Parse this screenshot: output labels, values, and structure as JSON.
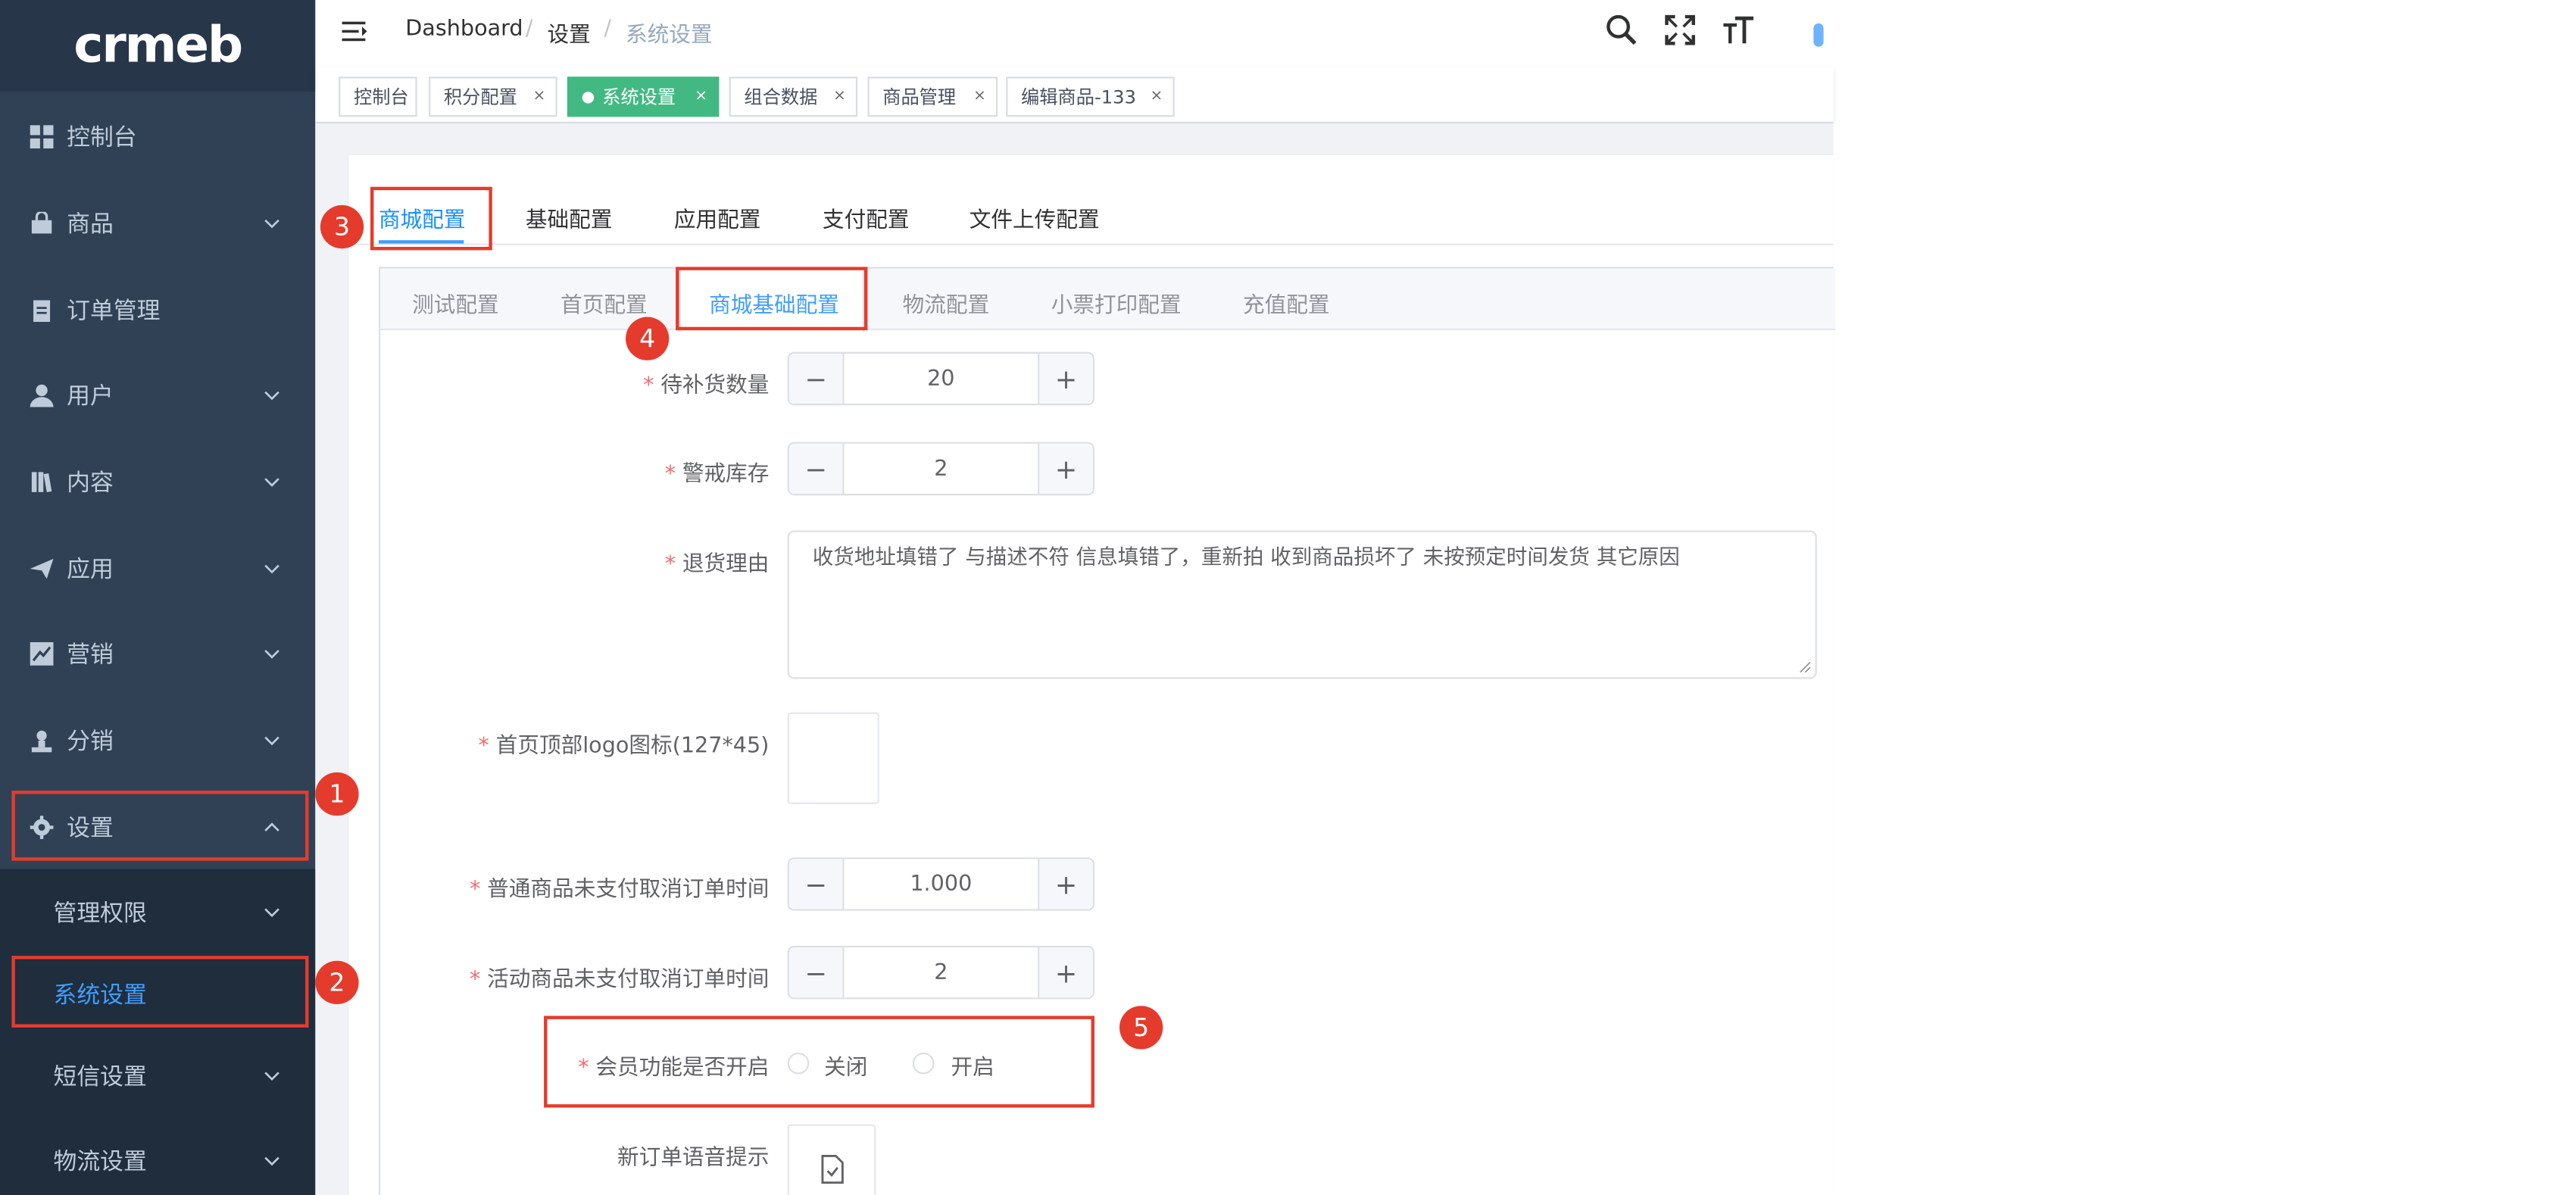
{
  "logo": {
    "text": "crmeb"
  },
  "sidebar": {
    "items": [
      {
        "label": "控制台",
        "icon": "dashboard-grid-icon",
        "has_arrow": false
      },
      {
        "label": "商品",
        "icon": "shopping-bag-icon",
        "has_arrow": true
      },
      {
        "label": "订单管理",
        "icon": "clipboard-icon",
        "has_arrow": false
      },
      {
        "label": "用户",
        "icon": "user-icon",
        "has_arrow": true
      },
      {
        "label": "内容",
        "icon": "book-icon",
        "has_arrow": true
      },
      {
        "label": "应用",
        "icon": "paper-plane-icon",
        "has_arrow": true
      },
      {
        "label": "营销",
        "icon": "chart-icon",
        "has_arrow": true
      },
      {
        "label": "分销",
        "icon": "person-stamp-icon",
        "has_arrow": true
      },
      {
        "label": "设置",
        "icon": "gear-icon",
        "has_arrow": true,
        "expanded": true
      }
    ],
    "submenu": [
      {
        "label": "管理权限",
        "has_arrow": true
      },
      {
        "label": "系统设置",
        "active": true,
        "has_arrow": false
      },
      {
        "label": "短信设置",
        "has_arrow": true
      },
      {
        "label": "物流设置",
        "has_arrow": true
      }
    ]
  },
  "navbar": {
    "breadcrumb": [
      "Dashboard",
      "设置",
      "系统设置"
    ],
    "separator": "/",
    "icons": [
      "search-icon",
      "fullscreen-icon",
      "font-size-icon"
    ]
  },
  "tags": [
    {
      "label": "控制台",
      "closable": false
    },
    {
      "label": "积分配置",
      "closable": true
    },
    {
      "label": "系统设置",
      "closable": true,
      "active": true
    },
    {
      "label": "组合数据",
      "closable": true
    },
    {
      "label": "商品管理",
      "closable": true
    },
    {
      "label": "编辑商品-133",
      "closable": true
    }
  ],
  "tag_close": "×",
  "top_tabs": [
    "商城配置",
    "基础配置",
    "应用配置",
    "支付配置",
    "文件上传配置"
  ],
  "inner_tabs": [
    "测试配置",
    "首页配置",
    "商城基础配置",
    "物流配置",
    "小票打印配置",
    "充值配置"
  ],
  "form": {
    "required_mark": "*",
    "minus": "−",
    "plus": "+",
    "restock_qty": {
      "label": "待补货数量",
      "value": "20"
    },
    "stock_warning": {
      "label": "警戒库存",
      "value": "2"
    },
    "return_reasons": {
      "label": "退货理由",
      "value": "收货地址填错了 与描述不符 信息填错了，重新拍 收到商品损坏了 未按预定时间发货 其它原因"
    },
    "home_logo": {
      "label": "首页顶部logo图标(127*45)"
    },
    "normal_unpaid_cancel": {
      "label": "普通商品未支付取消订单时间",
      "value": "1.000"
    },
    "activity_unpaid_cancel": {
      "label": "活动商品未支付取消订单时间",
      "value": "2"
    },
    "member_enabled": {
      "label": "会员功能是否开启",
      "options": [
        "关闭",
        "开启"
      ],
      "selected": null
    },
    "new_order_audio": {
      "label": "新订单语音提示"
    }
  },
  "annotations": {
    "badges": [
      "1",
      "2",
      "3",
      "4",
      "5"
    ],
    "color": "#e53b2c"
  },
  "colors": {
    "sidebar_bg": "#304156",
    "sidebar_active_text": "#409eff",
    "tag_active": "#42b983",
    "primary": "#409eff",
    "required": "#f56c6c"
  }
}
